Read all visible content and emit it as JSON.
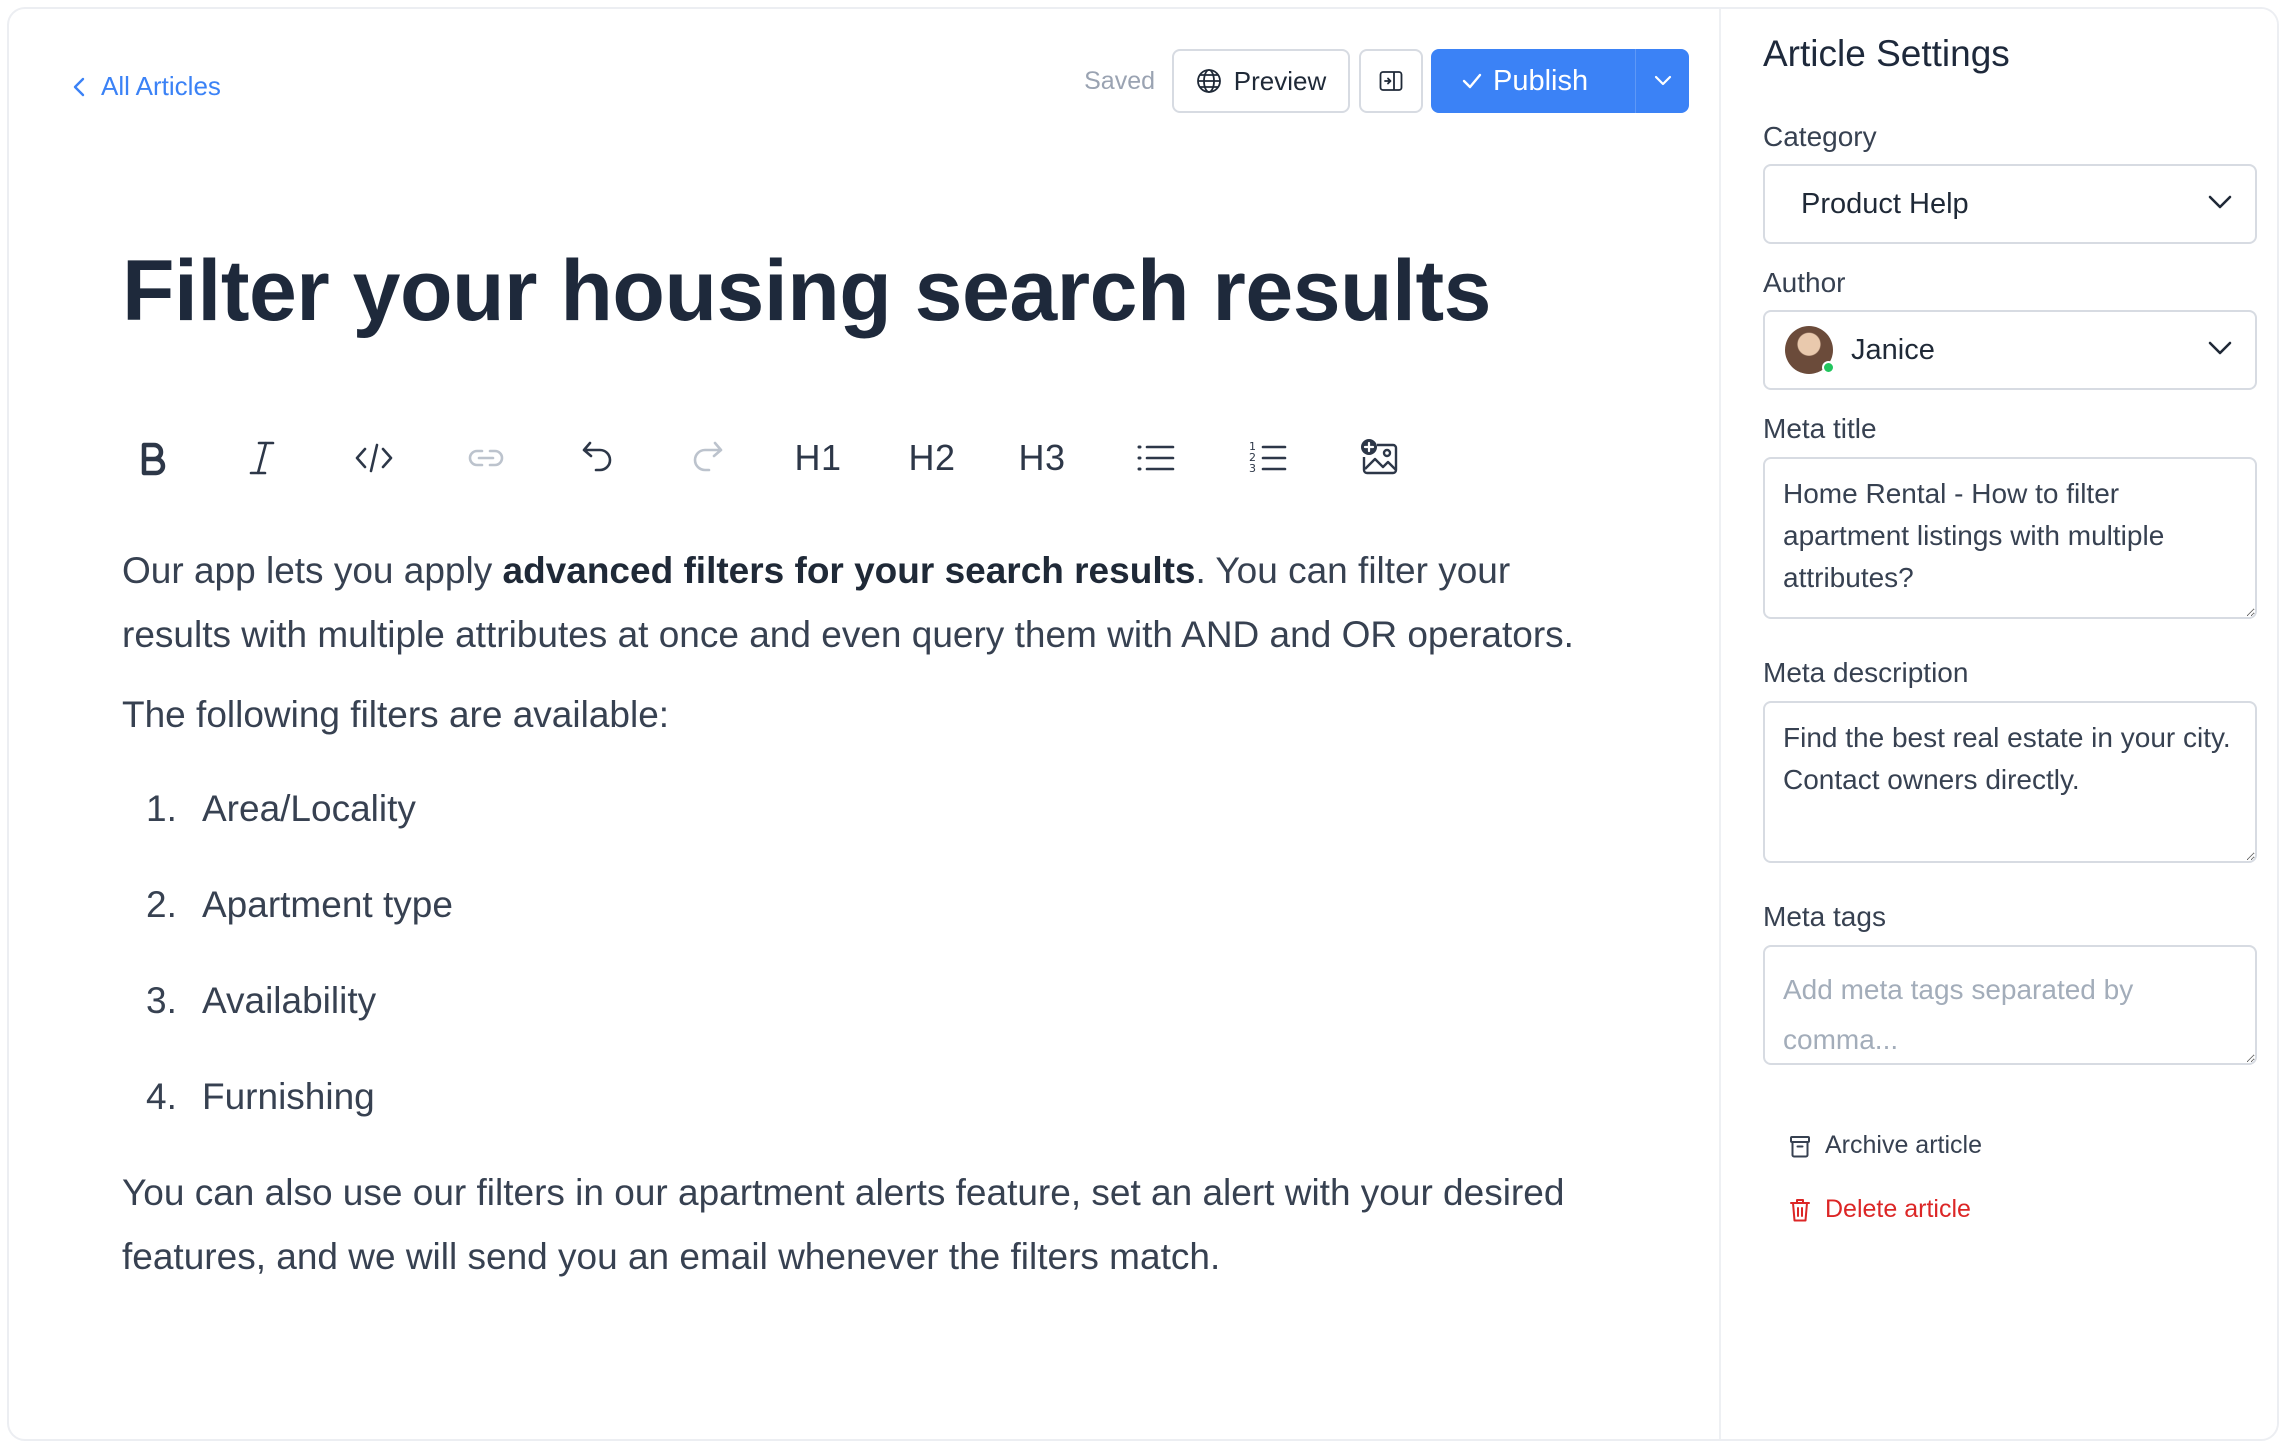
{
  "topbar": {
    "back_label": "All Articles",
    "status": "Saved",
    "preview_label": "Preview",
    "publish_label": "Publish"
  },
  "article": {
    "title": "Filter your housing search results",
    "para1_before": "Our app lets you apply ",
    "para1_bold": "advanced filters for your search results",
    "para1_after": ". You can filter your results with multiple attributes at once and even query them with AND and OR operators.",
    "para2": "The following filters are available:",
    "list": [
      {
        "num": "1.",
        "text": "Area/Locality"
      },
      {
        "num": "2.",
        "text": "Apartment type"
      },
      {
        "num": "3.",
        "text": "Availability"
      },
      {
        "num": "4.",
        "text": "Furnishing"
      }
    ],
    "para3": "You can also use our filters in our apartment alerts feature, set an alert with your desired features, and we will send you an email whenever the filters match."
  },
  "toolbar": {
    "h1": "H1",
    "h2": "H2",
    "h3": "H3",
    "icons": [
      "bold-icon",
      "italic-icon",
      "code-icon",
      "link-icon",
      "undo-icon",
      "redo-icon",
      "bullet-list-icon",
      "numbered-list-icon",
      "add-image-icon"
    ]
  },
  "sidebar": {
    "title": "Article Settings",
    "category_label": "Category",
    "category_value": "Product Help",
    "author_label": "Author",
    "author_value": "Janice",
    "meta_title_label": "Meta title",
    "meta_title_value": "Home Rental - How to filter apartment listings with multiple attributes?",
    "meta_description_label": "Meta description",
    "meta_description_value": "Find the best real estate in your city. Contact owners directly.",
    "meta_tags_label": "Meta tags",
    "meta_tags_placeholder": "Add meta tags separated by comma...",
    "archive_label": "Archive article",
    "delete_label": "Delete article"
  },
  "colors": {
    "accent": "#3b82f6",
    "danger": "#dc2626",
    "online": "#22c55e"
  }
}
